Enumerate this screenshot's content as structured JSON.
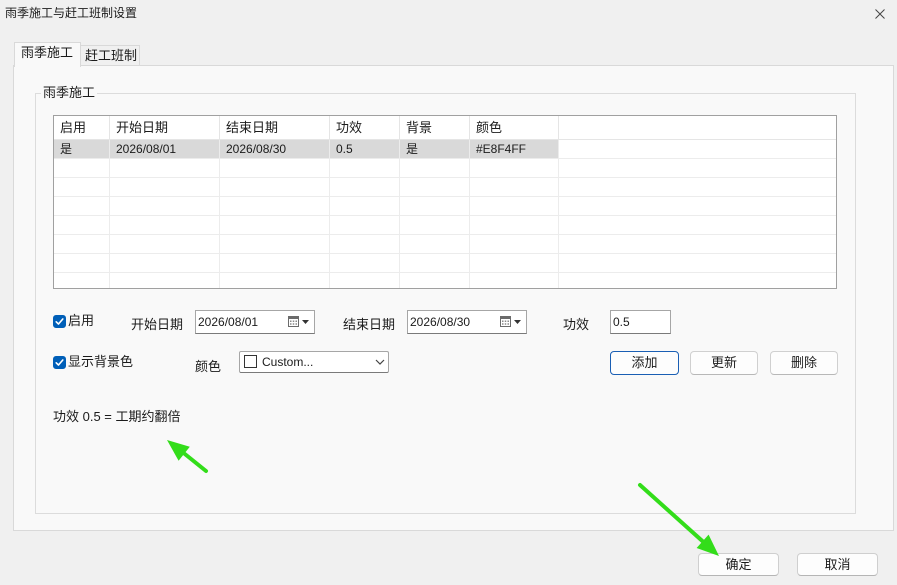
{
  "window": {
    "title": "雨季施工与赶工班制设置"
  },
  "tabs": [
    {
      "label": "雨季施工",
      "selected": true
    },
    {
      "label": "赶工班制",
      "selected": false
    }
  ],
  "group": {
    "title": "雨季施工"
  },
  "table": {
    "columns": [
      "启用",
      "开始日期",
      "结束日期",
      "功效",
      "背景",
      "颜色"
    ],
    "rows": [
      [
        "是",
        "2026/08/01",
        "2026/08/30",
        "0.5",
        "是",
        "#E8F4FF"
      ]
    ],
    "selected_row": 0
  },
  "form": {
    "enable": {
      "label": "启用",
      "checked": true
    },
    "start_date": {
      "label": "开始日期",
      "value": "2026/08/01"
    },
    "end_date": {
      "label": "结束日期",
      "value": "2026/08/30"
    },
    "efficiency": {
      "label": "功效",
      "value": "0.5"
    },
    "show_background": {
      "label": "显示背景色",
      "checked": true
    },
    "color": {
      "label": "颜色",
      "value": "Custom...",
      "swatch": "#ffffff"
    },
    "buttons": {
      "add": "添加",
      "update": "更新",
      "delete": "删除"
    }
  },
  "note": "功效 0.5 = 工期约翻倍",
  "footer": {
    "ok": "确定",
    "cancel": "取消"
  },
  "colors": {
    "background": "#f0f0f0",
    "panel": "#f9f9f9",
    "accent": "#005fb8",
    "focus_border": "#1a5fb4",
    "selected_row": "#d9d9d9",
    "annotation_arrow": "#33dd1a"
  },
  "icons": {
    "close": "close-icon",
    "calendar": "calendar-icon",
    "dropdown": "dropdown-arrow-icon",
    "chevron": "chevron-down-icon",
    "check": "checkmark-icon"
  }
}
